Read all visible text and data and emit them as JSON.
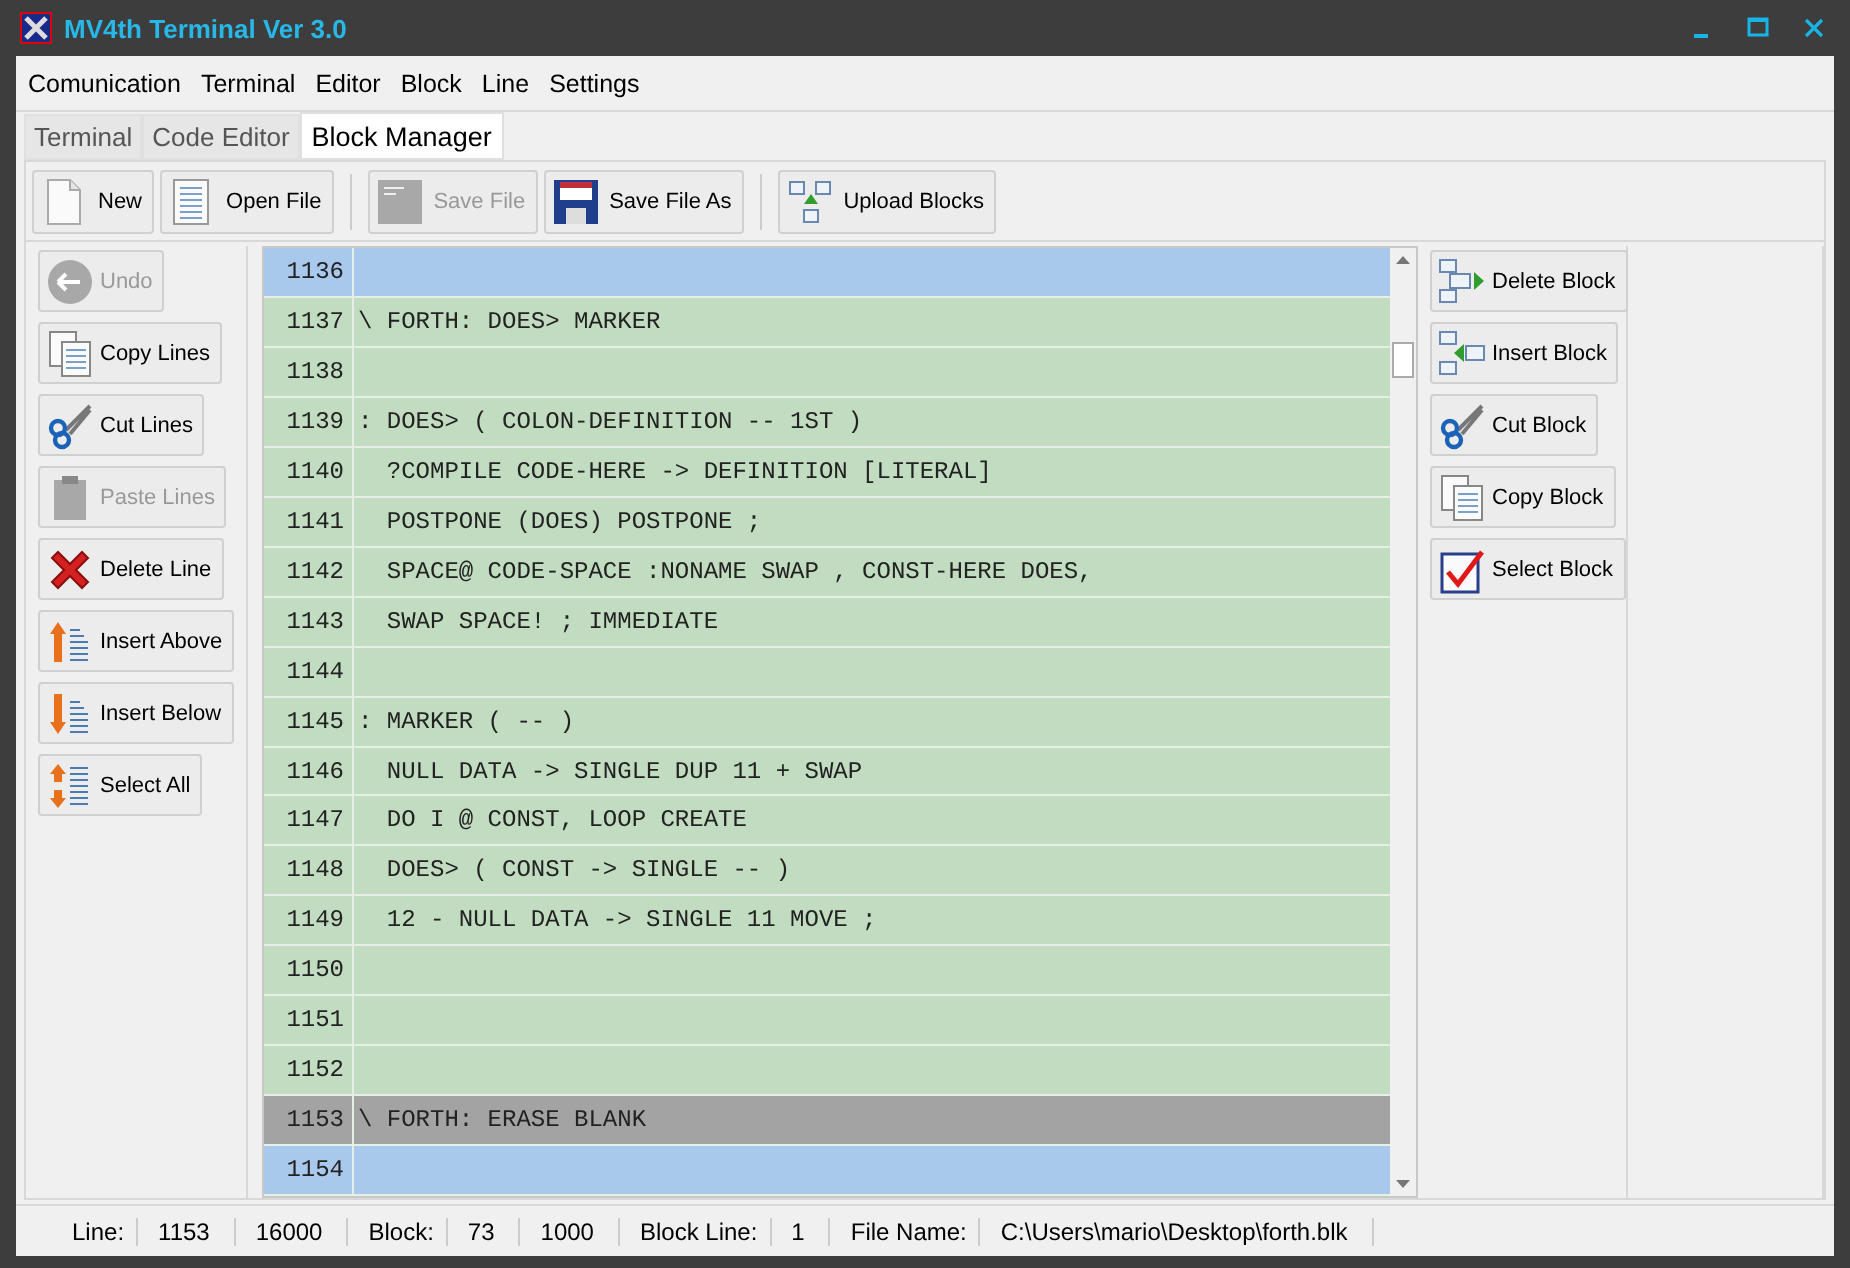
{
  "window": {
    "title": "MV4th Terminal Ver 3.0"
  },
  "menu": [
    "Comunication",
    "Terminal",
    "Editor",
    "Block",
    "Line",
    "Settings"
  ],
  "tabs": [
    {
      "label": "Terminal",
      "selected": false
    },
    {
      "label": "Code Editor",
      "selected": false
    },
    {
      "label": "Block Manager",
      "selected": true
    }
  ],
  "toolbar": [
    [
      {
        "label": "New",
        "disabled": false
      },
      {
        "label": "Open File",
        "disabled": false
      }
    ],
    [
      {
        "label": "Save File",
        "disabled": true
      },
      {
        "label": "Save File As",
        "disabled": false
      }
    ],
    [
      {
        "label": "Upload Blocks",
        "disabled": false
      }
    ]
  ],
  "line_buttons": [
    {
      "label": "Undo",
      "disabled": true
    },
    {
      "label": "Copy Lines",
      "disabled": false
    },
    {
      "label": "Cut Lines",
      "disabled": false
    },
    {
      "label": "Paste Lines",
      "disabled": true
    },
    {
      "label": "Delete Line",
      "disabled": false
    },
    {
      "label": "Insert Above",
      "disabled": false
    },
    {
      "label": "Insert Below",
      "disabled": false
    },
    {
      "label": "Select All",
      "disabled": false
    }
  ],
  "lines": [
    {
      "number": "1136",
      "kind": "boundary",
      "selected": false
    },
    {
      "number": "1137",
      "text": "\\ FORTH: DOES> MARKER",
      "kind": "line",
      "selected": false
    },
    {
      "number": "1138",
      "kind": "line",
      "selected": false
    },
    {
      "number": "1139",
      "text": ": DOES> ( COLON-DEFINITION -- 1ST )",
      "kind": "line",
      "selected": false
    },
    {
      "number": "1140",
      "text": "  ?COMPILE CODE-HERE -> DEFINITION [LITERAL]",
      "kind": "line",
      "selected": false
    },
    {
      "number": "1141",
      "text": "  POSTPONE (DOES) POSTPONE ;",
      "kind": "line",
      "selected": false
    },
    {
      "number": "1142",
      "text": "  SPACE@ CODE-SPACE :NONAME SWAP , CONST-HERE DOES,",
      "kind": "line",
      "selected": false
    },
    {
      "number": "1143",
      "text": "  SWAP SPACE! ; IMMEDIATE",
      "kind": "line",
      "selected": false
    },
    {
      "number": "1144",
      "kind": "line",
      "selected": false
    },
    {
      "number": "1145",
      "text": ": MARKER ( -- )",
      "kind": "line",
      "selected": false
    },
    {
      "number": "1146",
      "text": "  NULL DATA -> SINGLE DUP 11 + SWAP",
      "kind": "line",
      "selected": false
    },
    {
      "number": "1147",
      "text": "  DO I @ CONST, LOOP CREATE",
      "kind": "line",
      "selected": false
    },
    {
      "number": "1148",
      "text": "  DOES> ( CONST -> SINGLE -- )",
      "kind": "line",
      "selected": false
    },
    {
      "number": "1149",
      "text": "  12 - NULL DATA -> SINGLE 11 MOVE ;",
      "kind": "line",
      "selected": false
    },
    {
      "number": "1150",
      "kind": "line",
      "selected": false
    },
    {
      "number": "1151",
      "kind": "line",
      "selected": false
    },
    {
      "number": "1152",
      "kind": "line",
      "selected": false
    },
    {
      "number": "1153",
      "text": "\\ FORTH: ERASE BLANK",
      "kind": "line",
      "selected": true
    },
    {
      "number": "1154",
      "kind": "boundary",
      "selected": false
    }
  ],
  "block_buttons": [
    {
      "label": "Delete Block"
    },
    {
      "label": "Insert Block"
    },
    {
      "label": "Cut Block"
    },
    {
      "label": "Copy Block"
    },
    {
      "label": "Select Block"
    }
  ],
  "status_bar": [
    {
      "label": "Line:",
      "value": "1153"
    },
    {
      "value": "16000"
    },
    {
      "label": "Block:",
      "value": "73"
    },
    {
      "value": "1000"
    },
    {
      "label": "Block Line:",
      "value": "1"
    },
    {
      "label": "File Name:",
      "value": "C:\\Users\\mario\\Desktop\\forth.blk"
    }
  ]
}
